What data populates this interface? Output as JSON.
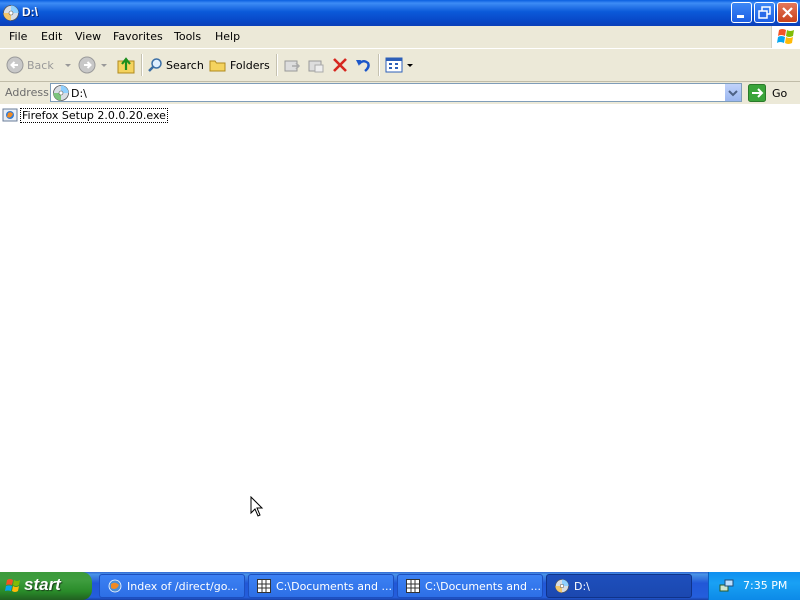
{
  "window": {
    "title": "D:\\",
    "controls": {
      "minimize_icon": "minimize-icon",
      "restore_icon": "restore-icon",
      "close_icon": "close-icon"
    }
  },
  "menubar": {
    "items": [
      "File",
      "Edit",
      "View",
      "Favorites",
      "Tools",
      "Help"
    ]
  },
  "toolbar": {
    "back_label": "Back",
    "search_label": "Search",
    "folders_label": "Folders"
  },
  "address": {
    "label": "Address",
    "value": "D:\\",
    "go_label": "Go"
  },
  "content": {
    "files": [
      {
        "name": "Firefox Setup 2.0.0.20.exe",
        "icon": "installer-icon"
      }
    ]
  },
  "taskbar": {
    "start_label": "start",
    "tasks": [
      {
        "label": "Index of /direct/go...",
        "icon": "browser-icon"
      },
      {
        "label": "C:\\Documents and ...",
        "icon": "window-icon"
      },
      {
        "label": "C:\\Documents and ...",
        "icon": "window-icon"
      },
      {
        "label": "D:\\",
        "icon": "cd-drive-icon"
      }
    ],
    "clock": "7:35 PM"
  },
  "colors": {
    "title_bar": "#0b5ad9",
    "taskbar": "#245edc",
    "start_button": "#3e9d3e",
    "chrome": "#ece9d8"
  }
}
